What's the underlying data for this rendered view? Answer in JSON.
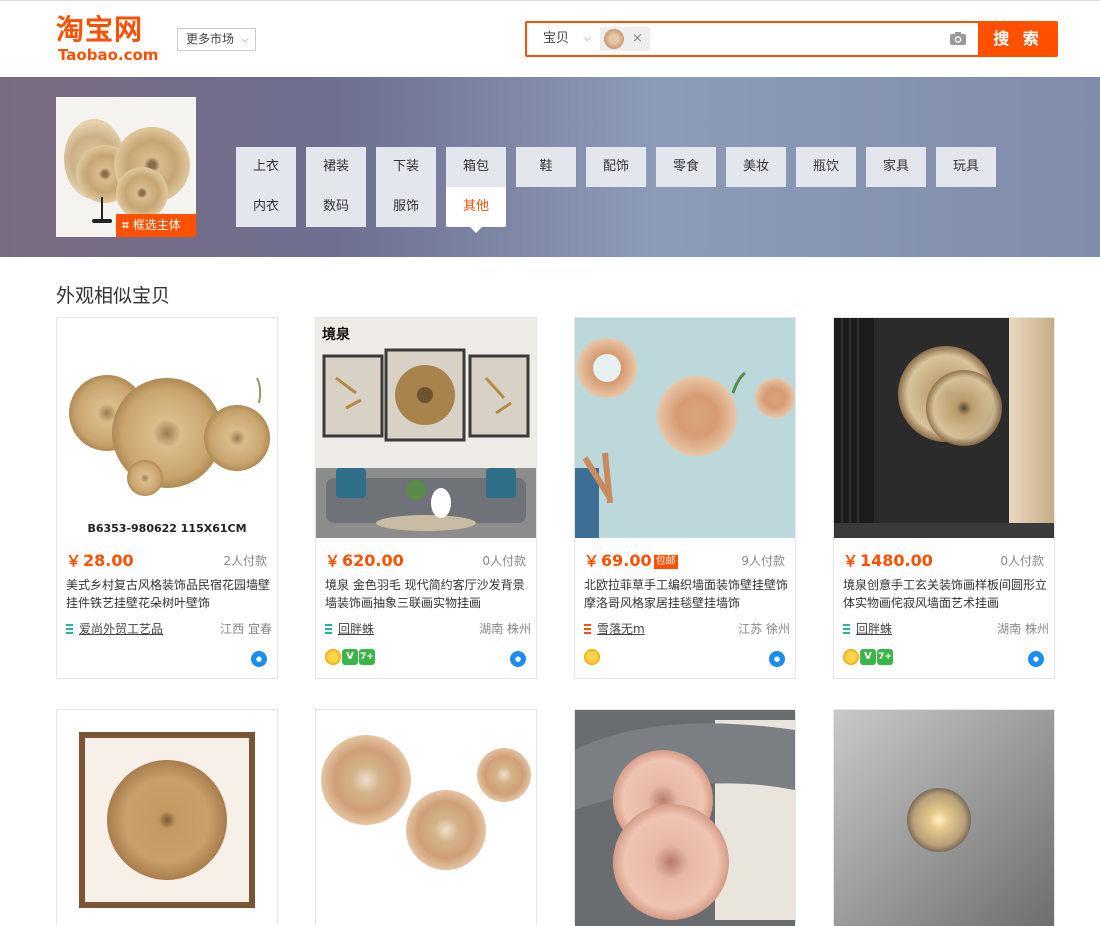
{
  "header": {
    "logo_cn": "淘宝网",
    "logo_en": "Taobao.com",
    "market_label": "更多市场",
    "search": {
      "type_label": "宝贝",
      "clear_symbol": "×",
      "button_label": "搜 索"
    }
  },
  "banner": {
    "crop_label": "框选主体",
    "categories": [
      "上衣",
      "裙装",
      "下装",
      "箱包",
      "鞋",
      "配饰",
      "零食",
      "美妆",
      "瓶饮",
      "家具",
      "玩具",
      "内衣",
      "数码",
      "服饰",
      "其他"
    ],
    "active_category": "其他"
  },
  "section_title": "外观相似宝贝",
  "products": [
    {
      "price": "28.00",
      "currency": "￥",
      "sold": "2人付款",
      "title": "美式乡村复古风格装饰品民宿花园墙壁挂件铁艺挂壁花朵树叶壁饰",
      "shop": "爱尚外贸工艺品",
      "location": "江西 宜春",
      "image_caption": "B6353-980622 115X61CM",
      "badges": []
    },
    {
      "price": "620.00",
      "currency": "￥",
      "sold": "0人付款",
      "title": "境泉 金色羽毛 现代简约客厅沙发背景墙装饰画抽象三联画实物挂画",
      "shop": "回胖蛛",
      "location": "湖南 株州",
      "image_caption": "境泉",
      "badges": [
        "crown",
        "v",
        "7"
      ]
    },
    {
      "price": "69.00",
      "currency": "￥",
      "tag": "包邮",
      "sold": "9人付款",
      "title": "北欧拉菲草手工编织墙面装饰壁挂壁饰摩洛哥风格家居挂毯壁挂墙饰",
      "shop": "雪落无m",
      "location": "江苏 徐州",
      "badges": [
        "crown"
      ]
    },
    {
      "price": "1480.00",
      "currency": "￥",
      "sold": "0人付款",
      "title": "境泉创意手工玄关装饰画样板间圆形立体实物画侘寂风墙面艺术挂画",
      "shop": "回胖蛛",
      "location": "湖南 株州",
      "badges": [
        "crown",
        "v",
        "7"
      ]
    }
  ],
  "colors": {
    "brand": "#ff5000",
    "banner_start": "#7a6c80",
    "banner_end": "#7f8cab"
  }
}
